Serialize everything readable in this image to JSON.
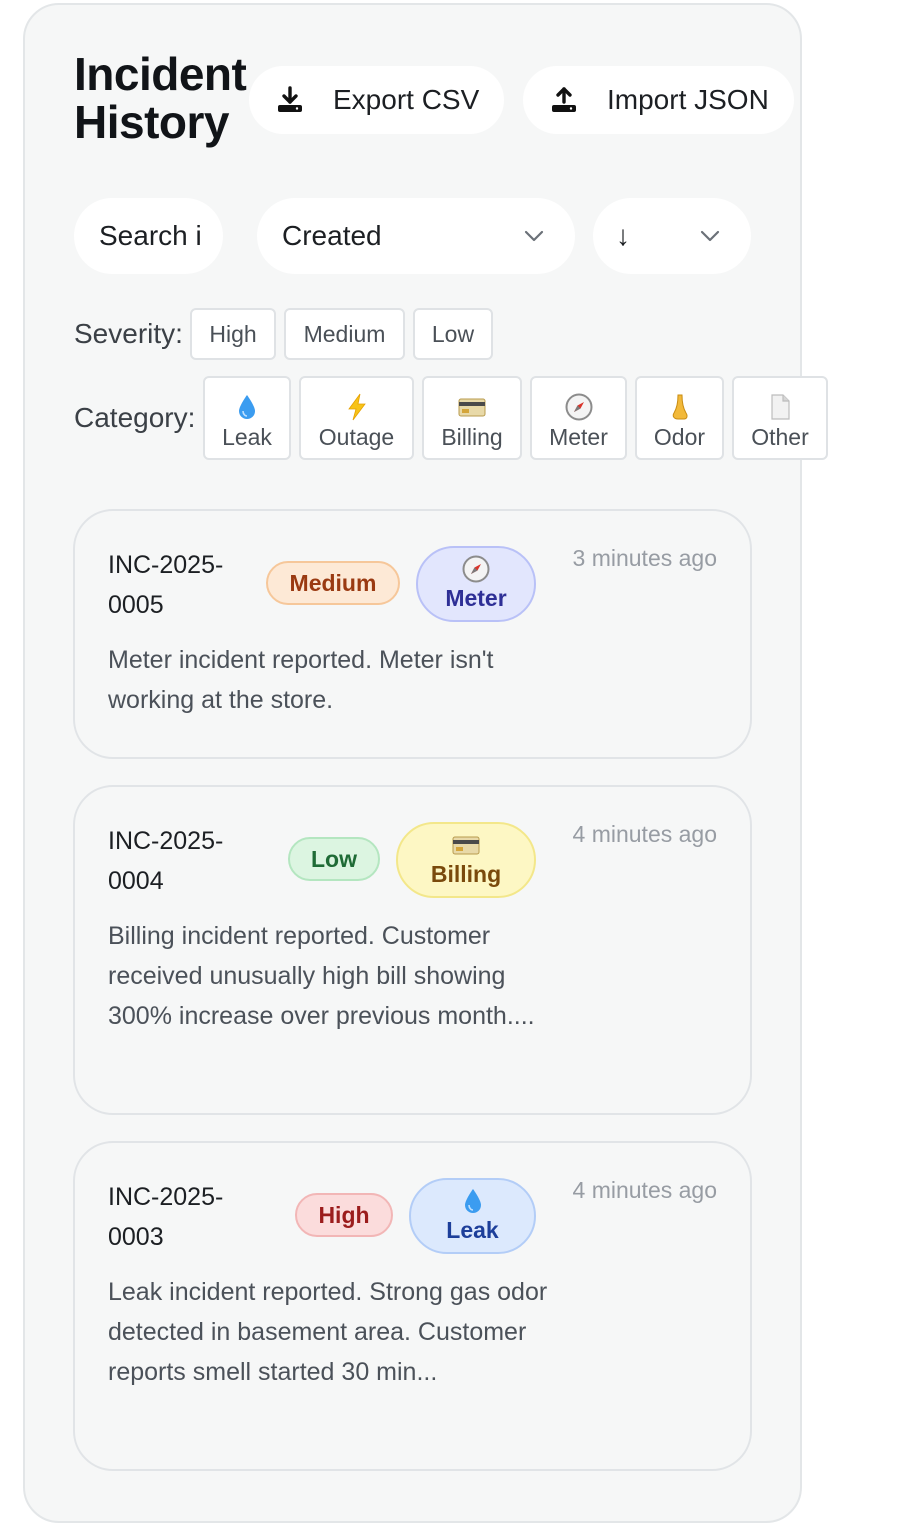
{
  "header": {
    "title": "Incident History",
    "export_label": "Export CSV",
    "import_label": "Import JSON"
  },
  "controls": {
    "search_placeholder": "Search i",
    "sort_field": "Created",
    "sort_direction": "↓"
  },
  "filters": {
    "severity_label": "Severity:",
    "severity_options": [
      "High",
      "Medium",
      "Low"
    ],
    "category_label": "Category:",
    "category_options": [
      {
        "label": "Leak",
        "icon": "droplet-icon"
      },
      {
        "label": "Outage",
        "icon": "lightning-icon"
      },
      {
        "label": "Billing",
        "icon": "credit-card-icon"
      },
      {
        "label": "Meter",
        "icon": "compass-icon"
      },
      {
        "label": "Odor",
        "icon": "nose-icon"
      },
      {
        "label": "Other",
        "icon": "document-icon"
      }
    ]
  },
  "incidents": [
    {
      "id": "INC-2025-0005",
      "severity": "Medium",
      "category": "Meter",
      "category_icon": "compass-icon",
      "time": "3 minutes ago",
      "description": "Meter incident reported. Meter isn't working at the store."
    },
    {
      "id": "INC-2025-0004",
      "severity": "Low",
      "category": "Billing",
      "category_icon": "credit-card-icon",
      "time": "4 minutes ago",
      "description": "Billing incident reported. Customer received unusually high bill showing 300% increase over previous month...."
    },
    {
      "id": "INC-2025-0003",
      "severity": "High",
      "category": "Leak",
      "category_icon": "droplet-icon",
      "time": "4 minutes ago",
      "description": "Leak incident reported. Strong gas odor detected in basement area. Customer reports smell started 30 min..."
    }
  ],
  "colors": {
    "medium_bg": "#fde9d6",
    "medium_border": "#f6c79a",
    "medium_text": "#9a3a12",
    "low_bg": "#dcf5e1",
    "low_border": "#b4e6c0",
    "low_text": "#1f6b36",
    "high_bg": "#fbdcdc",
    "high_border": "#f2b6b6",
    "high_text": "#9b1c1c",
    "meter_bg": "#e2e6fd",
    "meter_border": "#b9c1f7",
    "meter_text": "#2e2f96",
    "billing_bg": "#fdf7c4",
    "billing_border": "#f3e78a",
    "billing_text": "#7a4a0c",
    "leak_bg": "#dce9fd",
    "leak_border": "#b3cdf7",
    "leak_text": "#1d3f9a"
  }
}
